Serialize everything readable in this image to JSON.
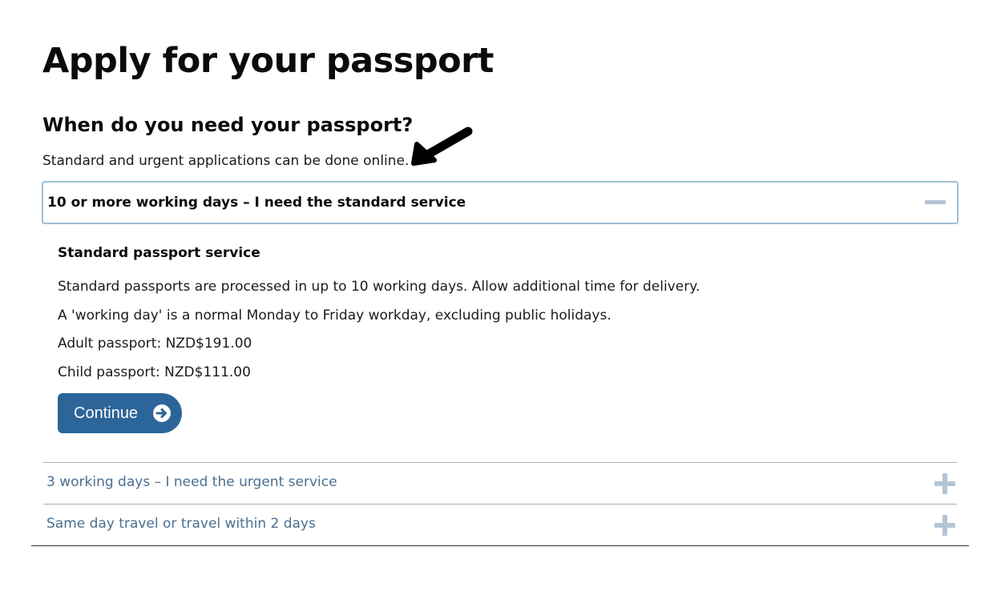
{
  "page": {
    "title": "Apply for your passport"
  },
  "when": {
    "heading": "When do you need your passport?",
    "intro": "Standard and urgent applications can be done online."
  },
  "accordion": {
    "open": {
      "title": "10 or more working days – I need the standard service",
      "panel": {
        "heading": "Standard passport service",
        "lines": [
          "Standard passports are processed in up to 10 working days. Allow additional time for delivery.",
          "A 'working day' is a normal Monday to Friday workday, excluding public holidays.",
          "Adult passport: NZD$191.00",
          "Child passport: NZD$111.00"
        ],
        "continue_label": "Continue"
      }
    },
    "closed": [
      {
        "title": "3 working days – I need the urgent service"
      },
      {
        "title": "Same day travel or travel within 2 days"
      }
    ]
  },
  "icons": {
    "collapse": "minus-icon",
    "expand": "plus-icon",
    "continue": "arrow-circle-right-icon",
    "annotation": "pointer-arrow-icon"
  },
  "colors": {
    "button": "#2c6599",
    "link": "#4a6f91",
    "accordion_border": "#9fbfd9",
    "icon": "#b3c4d4"
  }
}
